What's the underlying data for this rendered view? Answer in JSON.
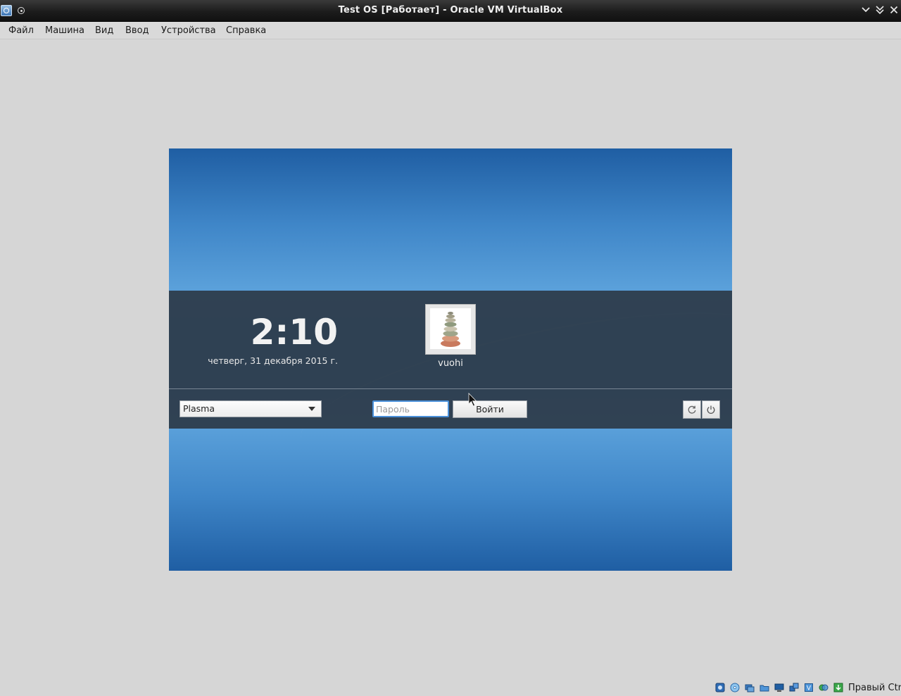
{
  "window": {
    "title": "Test OS [Работает] - Oracle VM VirtualBox"
  },
  "menubar": {
    "items": [
      "Файл",
      "Машина",
      "Вид",
      "Ввод",
      "Устройства",
      "Справка"
    ]
  },
  "login": {
    "time": "2:10",
    "date": "четверг, 31 декабря 2015 г.",
    "user_name": "vuohi",
    "session": "Plasma",
    "password_placeholder": "Пароль",
    "login_label": "Войти"
  },
  "statusbar": {
    "host_key": "Правый Ctrl",
    "icons": [
      "hard-disk-icon",
      "optical-drive-icon",
      "audio-icon",
      "network-icon",
      "usb-icon",
      "shared-folders-icon",
      "display-icon",
      "video-capture-icon",
      "mouse-integration-icon",
      "host-key-indicator-icon"
    ]
  },
  "colors": {
    "wallpaper_blue": "#3f86c8",
    "panel": "#2c3a48",
    "focus_ring": "#4a90d9"
  }
}
